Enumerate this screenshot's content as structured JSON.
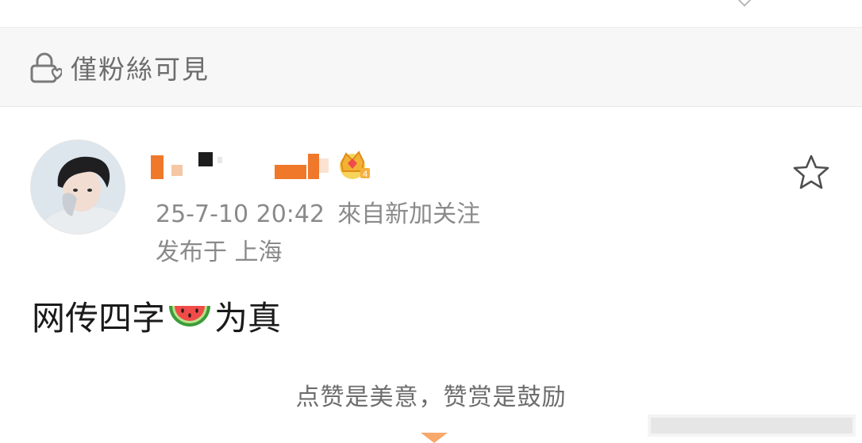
{
  "visibility": {
    "icon": "lock-heart-icon",
    "label": "僅粉絲可見"
  },
  "post": {
    "author": {
      "avatar": "avatar",
      "badge_icon": "crown-icon",
      "badge_level": "4"
    },
    "timestamp": "25-7-10 20:42",
    "source": "來自新加关注",
    "location": "发布于 上海",
    "text_before": "网传四字",
    "emoji": "watermelon-icon",
    "text_after": "为真",
    "favorite_icon": "star-icon"
  },
  "reward": {
    "note": "点赞是美意，赞赏是鼓励"
  },
  "colors": {
    "accent_orange": "#f47a23",
    "muted_text": "#8a8a8a",
    "body_text": "#1a1a1a",
    "bar_bg": "#f7f7f7"
  }
}
